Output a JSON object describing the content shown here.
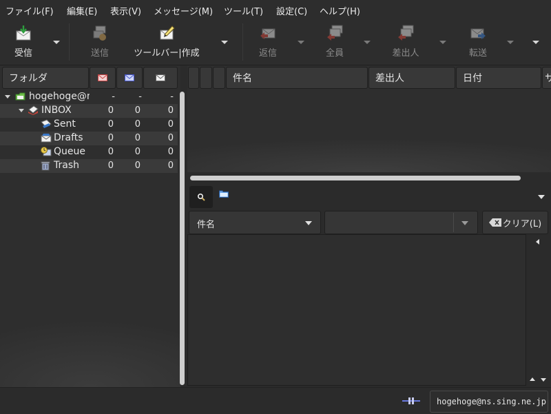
{
  "menubar": {
    "items": [
      {
        "label": "ファイル(F)"
      },
      {
        "label": "編集(E)"
      },
      {
        "label": "表示(V)"
      },
      {
        "label": "メッセージ(M)"
      },
      {
        "label": "ツール(T)"
      },
      {
        "label": "設定(C)"
      },
      {
        "label": "ヘルプ(H)"
      }
    ]
  },
  "toolbar": {
    "receive": {
      "label": "受信",
      "icon": "receive-icon",
      "enabled": true
    },
    "send": {
      "label": "送信",
      "icon": "send-icon",
      "enabled": false
    },
    "compose": {
      "label": "ツールバー|作成",
      "icon": "compose-icon",
      "enabled": true
    },
    "reply": {
      "label": "返信",
      "icon": "reply-icon",
      "enabled": false
    },
    "reply_all": {
      "label": "全員",
      "icon": "reply-all-icon",
      "enabled": false
    },
    "reply_sender": {
      "label": "差出人",
      "icon": "reply-sender-icon",
      "enabled": false
    },
    "forward": {
      "label": "転送",
      "icon": "forward-icon",
      "enabled": false
    }
  },
  "folder_pane": {
    "header": {
      "title": "フォルダ",
      "col_new": "new-mail-icon",
      "col_unread": "unread-mail-icon",
      "col_total": "total-mail-icon"
    },
    "folders": [
      {
        "name": "hogehoge@ns",
        "new": "-",
        "unread": "-",
        "total": "-",
        "icon": "account-icon"
      },
      {
        "name": "INBOX",
        "new": "0",
        "unread": "0",
        "total": "0",
        "icon": "inbox-icon"
      },
      {
        "name": "Sent",
        "new": "0",
        "unread": "0",
        "total": "0",
        "icon": "sent-icon"
      },
      {
        "name": "Drafts",
        "new": "0",
        "unread": "0",
        "total": "0",
        "icon": "drafts-icon"
      },
      {
        "name": "Queue",
        "new": "0",
        "unread": "0",
        "total": "0",
        "icon": "queue-icon"
      },
      {
        "name": "Trash",
        "new": "0",
        "unread": "0",
        "total": "0",
        "icon": "trash-icon"
      }
    ]
  },
  "message_list": {
    "columns": [
      "件名",
      "差出人",
      "日付",
      "サ"
    ]
  },
  "search": {
    "field_selected": "件名",
    "query_value": "",
    "clear_label": "クリア(L)"
  },
  "statusbar": {
    "account": "hogehoge@ns.sing.ne.jp"
  },
  "colors": {
    "background": "#2b2b2b",
    "panel": "#2e2e2e",
    "row_alt": "#3a3a3a",
    "text": "#e6e6e6",
    "disabled_text": "#8a8a8a"
  }
}
